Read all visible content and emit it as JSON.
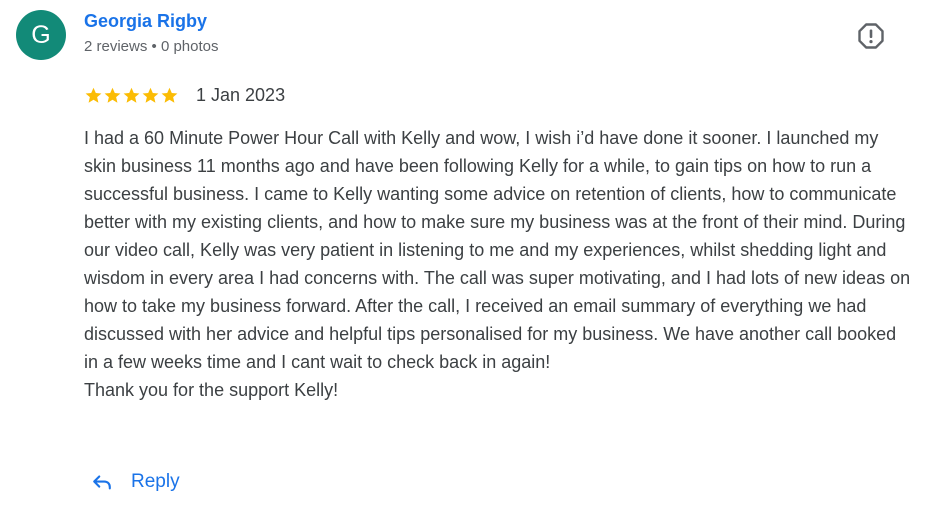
{
  "reviewer": {
    "initial": "G",
    "avatar_color": "#128a78",
    "name": "Georgia Rigby",
    "meta": "2 reviews • 0 photos"
  },
  "report_icon": "report-flag-icon",
  "rating": {
    "stars": 5,
    "max_stars": 5,
    "star_color": "#fbbc04",
    "date": "1 Jan 2023"
  },
  "review": {
    "paragraphs": [
      "I had a 60 Minute Power Hour Call with Kelly and wow, I wish i’d have done it sooner. I launched my skin business 11 months ago and have been following Kelly for a while, to gain tips on how to run a successful business. I came to Kelly wanting some advice on retention of clients, how to communicate better with my existing clients, and how to make sure my business was at the front of their mind. During our video call, Kelly was very patient in listening to me and my experiences, whilst shedding light and wisdom in every area I had concerns with. The call was super motivating, and I had lots of new ideas on how to take my business forward. After the call, I received an email summary of everything we had discussed with her advice and helpful tips personalised for my business. We have another call booked in a few weeks time and I cant wait to check back in again!",
      "Thank you for the support Kelly!"
    ]
  },
  "actions": {
    "reply_label": "Reply",
    "reply_icon": "reply-arrow-icon",
    "accent_color": "#1a73e8"
  }
}
